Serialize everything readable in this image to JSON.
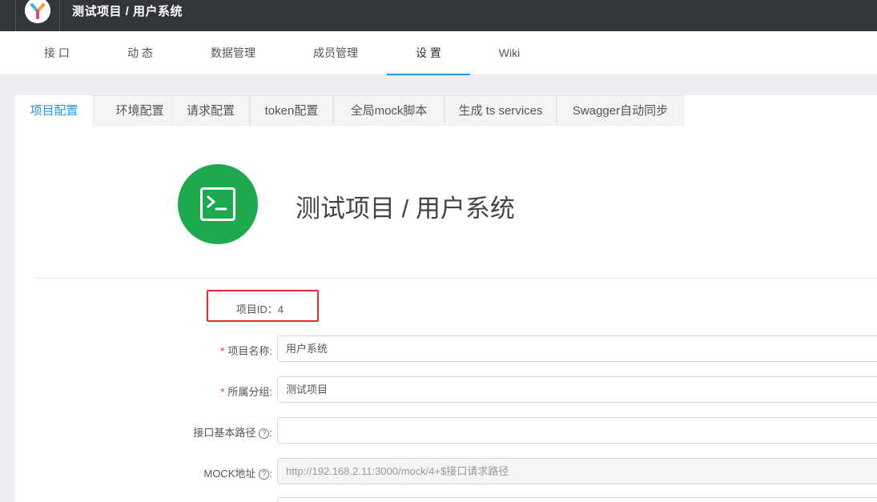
{
  "topbar": {
    "breadcrumb": "测试项目 / 用户系统",
    "logo_icon": "yapi-logo-icon"
  },
  "subnav": {
    "items": [
      "接 口",
      "动 态",
      "数据管理",
      "成员管理",
      "设 置",
      "Wiki"
    ],
    "active_index": 4,
    "accent": "#2395f1"
  },
  "settings_tabs": [
    "项目配置",
    "环境配置",
    "请求配置",
    "token配置",
    "全局mock脚本",
    "生成 ts services",
    "Swagger自动同步"
  ],
  "project": {
    "title": "测试项目 / 用户系统",
    "icon": "terminal-icon",
    "icon_color": "#1ea94f"
  },
  "form": {
    "id_label": "项目ID：",
    "id_value": "4",
    "name_label": "项目名称",
    "name_value": "用户系统",
    "group_label": "所属分组",
    "group_value": "测试项目",
    "basepath_label": "接口基本路径",
    "basepath_value": "",
    "mock_label": "MOCK地址",
    "mock_value": "http://192.168.2.11:3000/mock/4+$接口请求路径",
    "required_mark": "*",
    "colon": ":",
    "help_glyph": "?"
  }
}
